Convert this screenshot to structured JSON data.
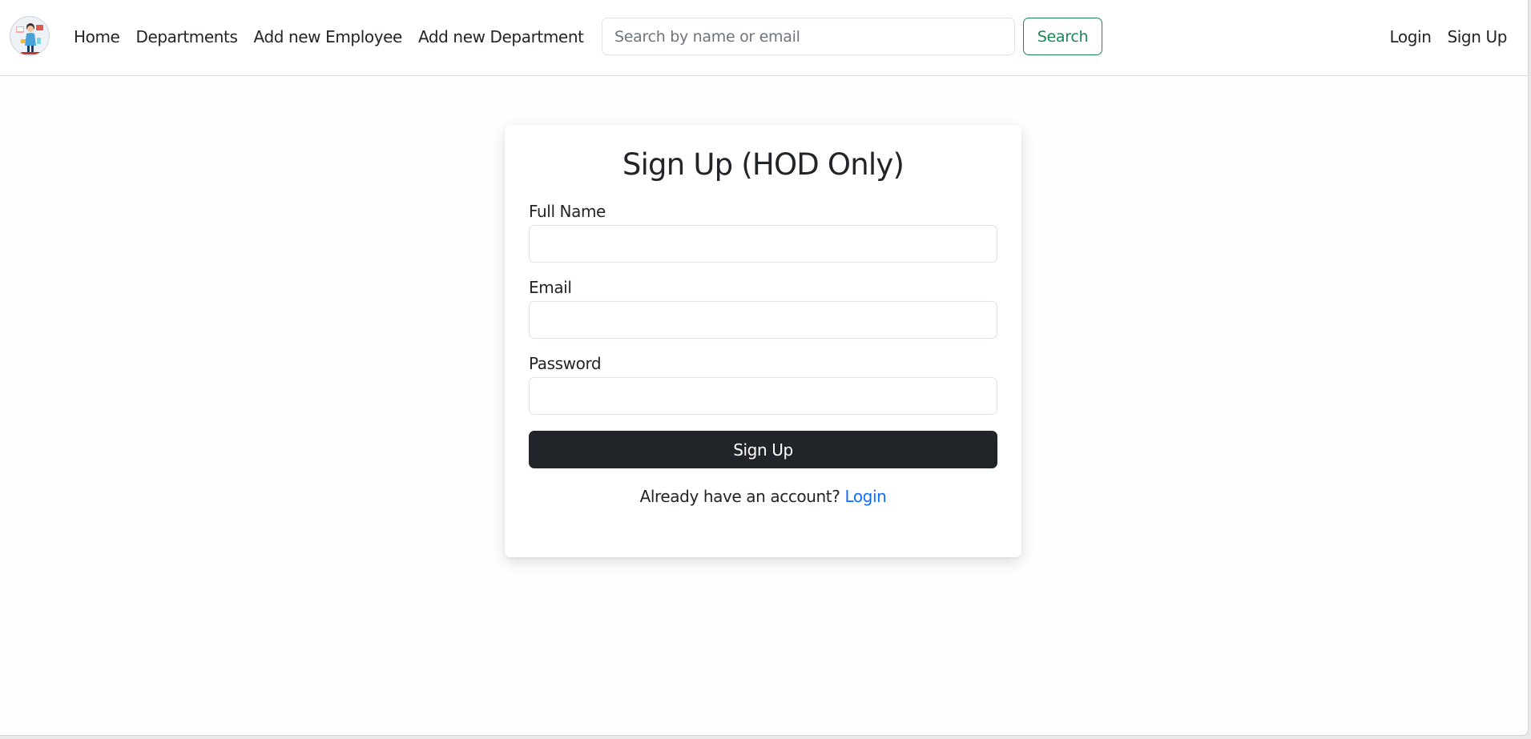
{
  "navbar": {
    "logo_alt": "logo",
    "links": [
      "Home",
      "Departments",
      "Add new Employee",
      "Add new Department"
    ],
    "search": {
      "placeholder": "Search by name or email",
      "value": "",
      "button_label": "Search"
    },
    "auth_links": {
      "login": "Login",
      "signup": "Sign Up"
    }
  },
  "signup_form": {
    "title": "Sign Up (HOD Only)",
    "fields": {
      "full_name": {
        "label": "Full Name",
        "value": ""
      },
      "email": {
        "label": "Email",
        "value": ""
      },
      "password": {
        "label": "Password",
        "value": ""
      }
    },
    "submit_label": "Sign Up",
    "footer_prompt": "Already have an account?",
    "footer_link": "Login"
  },
  "colors": {
    "primary_dark": "#212529",
    "success": "#198754",
    "link": "#0d6efd"
  }
}
